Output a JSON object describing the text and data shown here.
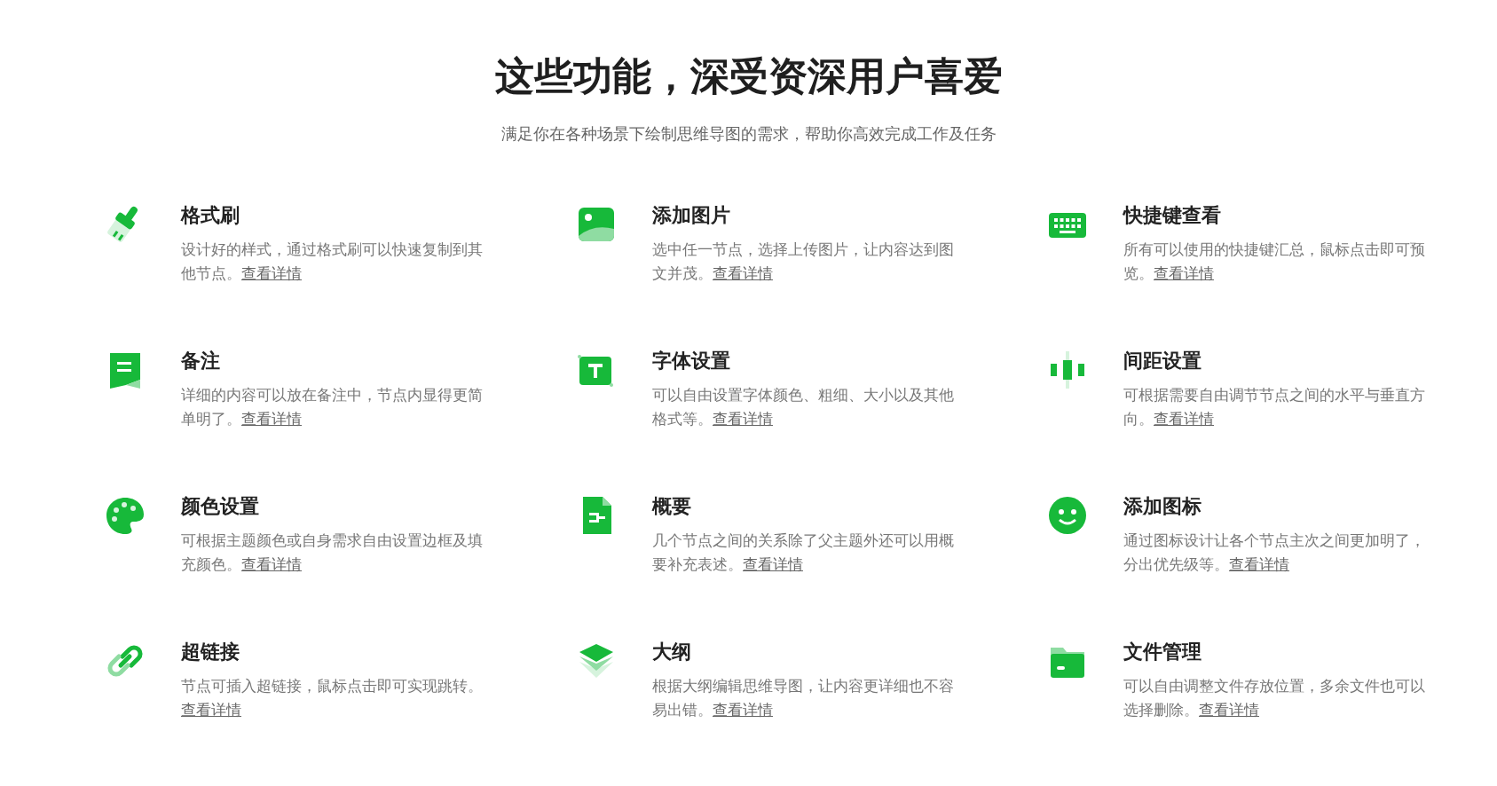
{
  "header": {
    "title": "这些功能，深受资深用户喜爱",
    "subtitle": "满足你在各种场景下绘制思维导图的需求，帮助你高效完成工作及任务"
  },
  "features": [
    {
      "title": "格式刷",
      "description": "设计好的样式，通过格式刷可以快速复制到其他节点。",
      "link": "查看详情"
    },
    {
      "title": "添加图片",
      "description": "选中任一节点，选择上传图片，让内容达到图文并茂。",
      "link": "查看详情"
    },
    {
      "title": "快捷键查看",
      "description": "所有可以使用的快捷键汇总，鼠标点击即可预览。",
      "link": "查看详情"
    },
    {
      "title": "备注",
      "description": "详细的内容可以放在备注中，节点内显得更简单明了。",
      "link": "查看详情"
    },
    {
      "title": "字体设置",
      "description": "可以自由设置字体颜色、粗细、大小以及其他格式等。",
      "link": "查看详情"
    },
    {
      "title": "间距设置",
      "description": "可根据需要自由调节节点之间的水平与垂直方向。",
      "link": "查看详情"
    },
    {
      "title": "颜色设置",
      "description": "可根据主题颜色或自身需求自由设置边框及填充颜色。",
      "link": "查看详情"
    },
    {
      "title": "概要",
      "description": "几个节点之间的关系除了父主题外还可以用概要补充表述。",
      "link": "查看详情"
    },
    {
      "title": "添加图标",
      "description": "通过图标设计让各个节点主次之间更加明了，分出优先级等。",
      "link": "查看详情"
    },
    {
      "title": "超链接",
      "description": "节点可插入超链接，鼠标点击即可实现跳转。",
      "link": "查看详情"
    },
    {
      "title": "大纲",
      "description": "根据大纲编辑思维导图，让内容更详细也不容易出错。",
      "link": "查看详情"
    },
    {
      "title": "文件管理",
      "description": "可以自由调整文件存放位置，多余文件也可以选择删除。",
      "link": "查看详情"
    }
  ]
}
